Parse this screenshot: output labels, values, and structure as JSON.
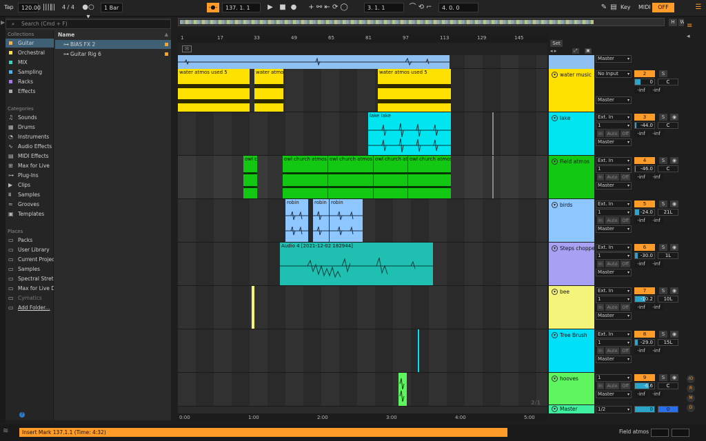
{
  "transport": {
    "tap": "Tap",
    "tempo": "120.00",
    "time_sig": "4 / 4",
    "quantize": "1 Bar",
    "position": "137.  1.  1",
    "loop_start": "3.  1.  1",
    "loop_length": "4.  0.  0",
    "key_label": "Key",
    "midi_label": "MIDI",
    "off_label": "OFF"
  },
  "browser": {
    "search_placeholder": "Search (Cmd + F)",
    "collections_head": "Collections",
    "collections": [
      {
        "label": "Guitar",
        "color": "#ffb030",
        "selected": true
      },
      {
        "label": "Orchestral",
        "color": "#ffe13a"
      },
      {
        "label": "MIX",
        "color": "#30d7c0"
      },
      {
        "label": "Sampling",
        "color": "#3fb8ff"
      },
      {
        "label": "Racks",
        "color": "#b070ff"
      },
      {
        "label": "Effects",
        "color": "#aaaaaa"
      }
    ],
    "categories_head": "Categories",
    "categories": [
      "Sounds",
      "Drums",
      "Instruments",
      "Audio Effects",
      "MIDI Effects",
      "Max for Live",
      "Plug-Ins",
      "Clips",
      "Samples",
      "Grooves",
      "Templates"
    ],
    "places_head": "Places",
    "places": [
      "Packs",
      "User Library",
      "Current Projec",
      "Samples",
      "Spectral Streto",
      "Max for Live De",
      "Cymatics",
      "Add Folder..."
    ],
    "name_head": "Name",
    "items": [
      {
        "label": "BIAS FX 2",
        "selected": true
      },
      {
        "label": "Guitar Rig 6",
        "selected": false
      }
    ]
  },
  "ruler": {
    "bars": [
      "1",
      "17",
      "33",
      "49",
      "65",
      "81",
      "97",
      "113",
      "129",
      "145"
    ],
    "set_label": "Set"
  },
  "timeline": {
    "times": [
      "0:00",
      "1:00",
      "2:00",
      "3:00",
      "4:00",
      "5:00"
    ],
    "zoom": "2/1"
  },
  "clips": {
    "water1": "water atmos used 5",
    "water2": "water atmo",
    "water3": "water atmos used 5",
    "lake": "lake lake",
    "owl1": "owl ch",
    "owl2": "owl church atmos",
    "owl3": "owl church atmos",
    "owl4": "owl church atmos",
    "owl5": "owl church atmos",
    "robin1": "robin",
    "robin2": "robin",
    "robin3": "robin",
    "audio4": "Audio 4 [2021-12-02 182944]"
  },
  "tracks": [
    {
      "name": "water music",
      "color": "#ffe100",
      "input": "No Input",
      "chan": "",
      "num": "2",
      "vol": "0",
      "pan": "C",
      "out": "Master"
    },
    {
      "name": "lake",
      "color": "#00e5f0",
      "input": "Ext. In",
      "chan": "1",
      "num": "3",
      "vol": "-44.0",
      "pan": "C",
      "out": "Master"
    },
    {
      "name": "Field atmos",
      "color": "#12c812",
      "input": "Ext. In",
      "chan": "1",
      "num": "4",
      "vol": "-46.0",
      "pan": "C",
      "out": "Master"
    },
    {
      "name": "birds",
      "color": "#8ec7ff",
      "input": "Ext. In",
      "chan": "1",
      "num": "5",
      "vol": "-24.0",
      "pan": "21L",
      "out": "Master"
    },
    {
      "name": "Steps choppe",
      "color": "#a8a0f2",
      "input": "Ext. In",
      "chan": "1",
      "num": "6",
      "vol": "-30.0",
      "pan": "1L",
      "out": "Master"
    },
    {
      "name": "bee",
      "color": "#f4f47a",
      "input": "Ext. In",
      "chan": "1",
      "num": "7",
      "vol": "-10.2",
      "pan": "10L",
      "out": "Master"
    },
    {
      "name": "Tree Brush",
      "color": "#00e0f8",
      "input": "Ext. In",
      "chan": "1",
      "num": "8",
      "vol": "-29.0",
      "pan": "15L",
      "out": "Master"
    },
    {
      "name": "hooves",
      "color": "#5ef55e",
      "input": "",
      "chan": "1",
      "num": "9",
      "vol": "-6.6",
      "pan": "C",
      "out": "Master"
    }
  ],
  "master": {
    "name": "Master",
    "chan": "1/2",
    "vol": "0",
    "pan": "0"
  },
  "io_labels": {
    "in": "In",
    "auto": "Auto",
    "off": "Off",
    "inf": "-inf",
    "solo": "S"
  },
  "status": {
    "message": "Insert Mark 137.1.1 (Time: 4:32)",
    "track": "Field atmos"
  }
}
